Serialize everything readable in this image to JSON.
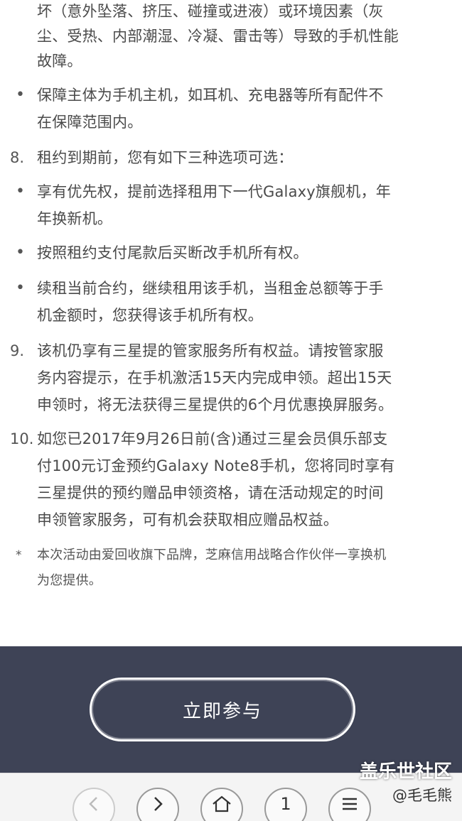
{
  "terms": [
    {
      "marker": "",
      "type": "cont",
      "lines": [
        "坏（意外坠落、挤压、碰撞或进液）或环境因素（灰",
        "尘、受热、内部潮湿、冷凝、雷击等）导致的手机性能",
        "故障。"
      ]
    },
    {
      "marker": "•",
      "type": "bullet",
      "lines": [
        "保障主体为手机主机，如耳机、充电器等所有配件不",
        "在保障范围内。"
      ]
    },
    {
      "marker": "8.",
      "type": "num",
      "lines": [
        "租约到期前，您有如下三种选项可选："
      ]
    },
    {
      "marker": "•",
      "type": "bullet",
      "lines": [
        "享有优先权，提前选择租用下一代Galaxy旗舰机，年",
        "年换新机。"
      ]
    },
    {
      "marker": "•",
      "type": "bullet",
      "lines": [
        "按照租约支付尾款后买断改手机所有权。"
      ]
    },
    {
      "marker": "•",
      "type": "bullet",
      "lines": [
        "续租当前合约，继续租用该手机，当租金总额等于手",
        "机金额时，您获得该手机所有权。"
      ]
    },
    {
      "marker": "9.",
      "type": "num",
      "lines": [
        "该机仍享有三星提的管家服务所有权益。请按管家服",
        "务内容提示，在手机激活15天内完成申领。超出15天",
        "申领时，将无法获得三星提供的6个月优惠换屏服务。"
      ]
    },
    {
      "marker": "10.",
      "type": "num",
      "lines": [
        "如您已2017年9月26日前(含)通过三星会员俱乐部支",
        "付100元订金预约Galaxy Note8手机，您将同时享有",
        "三星提供的预约赠品申领资格，请在活动规定的时间",
        "申领管家服务，可有机会获取相应赠品权益。"
      ]
    },
    {
      "marker": "*",
      "type": "star",
      "lines": [
        "本次活动由爱回收旗下品牌，芝麻信用战略合作伙伴一享换机",
        "为您提供。"
      ]
    }
  ],
  "cta": {
    "label": "立即参与"
  },
  "watermark": {
    "title": "盖乐世社区",
    "user": "@毛毛熊"
  },
  "nav": {
    "tab_count": "1"
  },
  "colors": {
    "cta_bg": "#3e4356",
    "text": "#4a4a4a"
  }
}
